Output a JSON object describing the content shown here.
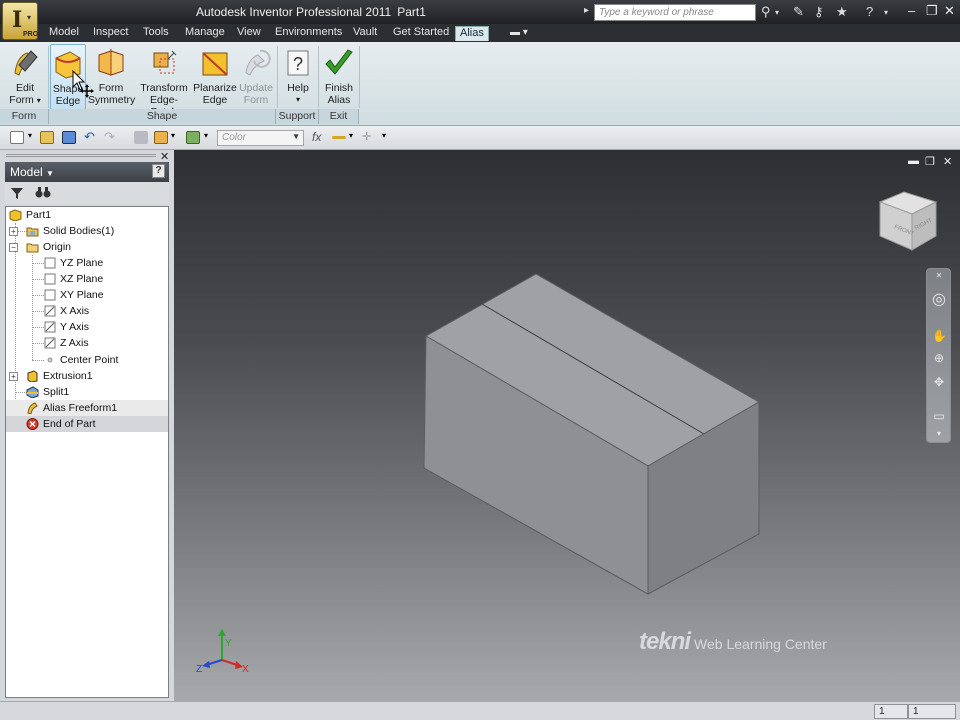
{
  "app": {
    "title": "Autodesk Inventor Professional 2011",
    "document": "Part1",
    "badge": "PRO",
    "search_placeholder": "Type a keyword or phrase"
  },
  "tabs": [
    {
      "label": "Model"
    },
    {
      "label": "Inspect"
    },
    {
      "label": "Tools"
    },
    {
      "label": "Manage"
    },
    {
      "label": "View"
    },
    {
      "label": "Environments"
    },
    {
      "label": "Vault"
    },
    {
      "label": "Get Started"
    },
    {
      "label": "Alias",
      "active": true
    }
  ],
  "ribbon": {
    "buttons": [
      {
        "line1": "Edit",
        "line2": "Form"
      },
      {
        "line1": "Shape",
        "line2": "Edge"
      },
      {
        "line1": "Form",
        "line2": "Symmetry"
      },
      {
        "line1": "Transform",
        "line2": "Edge-Patch"
      },
      {
        "line1": "Planarize",
        "line2": "Edge"
      },
      {
        "line1": "Update",
        "line2": "Form"
      },
      {
        "line1": "Help",
        "line2": ""
      },
      {
        "line1": "Finish",
        "line2": "Alias"
      }
    ],
    "groups": [
      {
        "label": "Form"
      },
      {
        "label": "Shape"
      },
      {
        "label": "Support"
      },
      {
        "label": "Exit"
      }
    ]
  },
  "toolbar": {
    "color_placeholder": "Color",
    "fx_label": "fx"
  },
  "browser": {
    "header": "Model",
    "help": "?",
    "nodes": [
      {
        "label": "Part1"
      },
      {
        "label": "Solid Bodies(1)"
      },
      {
        "label": "Origin"
      },
      {
        "label": "YZ Plane"
      },
      {
        "label": "XZ Plane"
      },
      {
        "label": "XY Plane"
      },
      {
        "label": "X Axis"
      },
      {
        "label": "Y Axis"
      },
      {
        "label": "Z Axis"
      },
      {
        "label": "Center Point"
      },
      {
        "label": "Extrusion1"
      },
      {
        "label": "Split1"
      },
      {
        "label": "Alias Freeform1"
      },
      {
        "label": "End of Part"
      }
    ]
  },
  "viewport": {
    "viewcube_front": "FRONT",
    "viewcube_right": "RIGHT",
    "triad": {
      "x": "X",
      "y": "Y",
      "z": "Z"
    },
    "watermark_brand": "tekni",
    "watermark_sub": "Web Learning Center"
  },
  "status": {
    "field1": "1",
    "field2": "1"
  },
  "colors": {
    "ribbon_bg": "#dde7ea",
    "title_bar": "#2a2d31",
    "accent_green": "#3a9a2a",
    "part_icon_yellow": "#f2c22c"
  }
}
